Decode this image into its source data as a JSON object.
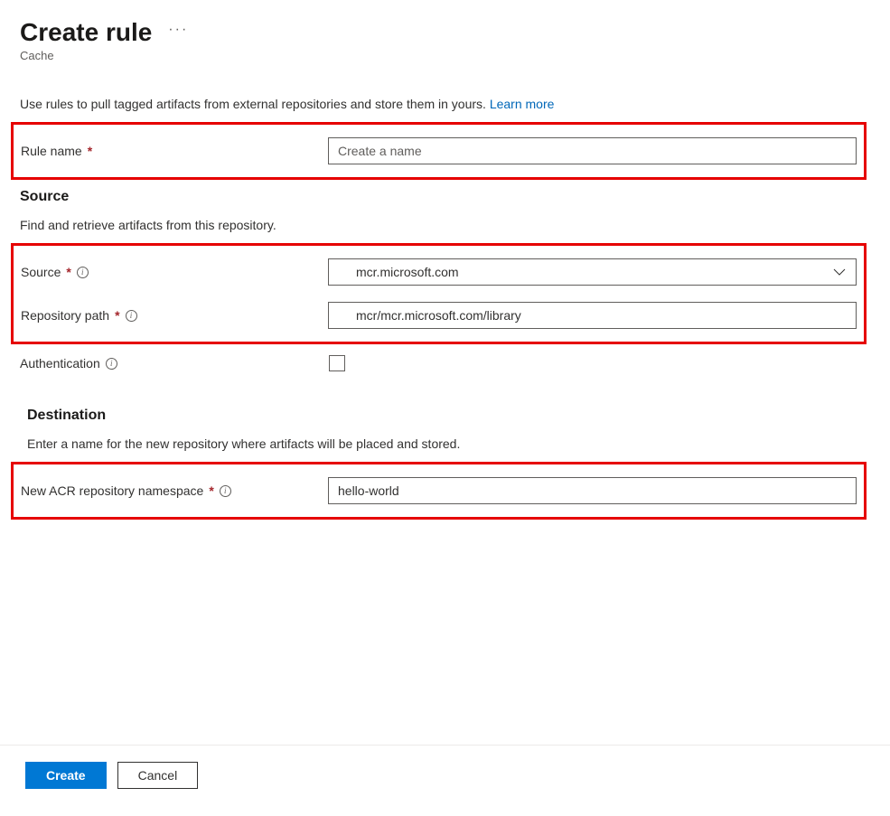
{
  "header": {
    "title": "Create rule",
    "subtitle": "Cache"
  },
  "intro": {
    "text": "Use rules to pull tagged artifacts from external repositories and store them in yours. ",
    "learn_more": "Learn more"
  },
  "rule_name": {
    "label": "Rule name",
    "placeholder": "Create a name",
    "value": ""
  },
  "source_section": {
    "heading": "Source",
    "description": "Find and retrieve artifacts from this repository.",
    "source": {
      "label": "Source",
      "value": "mcr.microsoft.com"
    },
    "repo_path": {
      "label": "Repository path",
      "value": "mcr/mcr.microsoft.com/library"
    },
    "auth": {
      "label": "Authentication",
      "checked": false
    }
  },
  "destination_section": {
    "heading": "Destination",
    "description": "Enter a name for the new repository where artifacts will be placed and stored.",
    "namespace": {
      "label": "New ACR repository namespace",
      "value": "hello-world"
    }
  },
  "footer": {
    "create": "Create",
    "cancel": "Cancel"
  }
}
